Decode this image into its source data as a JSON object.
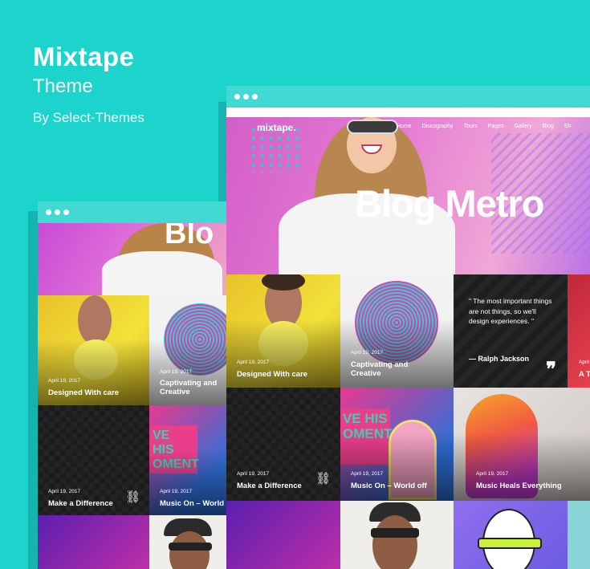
{
  "brand": {
    "title": "Mixtape",
    "subtitle": "Theme",
    "byline": "By Select-Themes"
  },
  "large_window": {
    "logo": "mixtape.",
    "menu": [
      "Home",
      "Discography",
      "Tours",
      "Pages",
      "Gallery",
      "Blog",
      "Sh"
    ],
    "hero_title": "Blog Metro",
    "tiles": {
      "t1": {
        "date": "April 19, 2017",
        "title": "Designed With care"
      },
      "t2": {
        "date": "April 19, 2017",
        "title": "Captivating and Creative"
      },
      "quote": {
        "text": "\" The most important things are not things, so we'll design experiences. \"",
        "author": "— Ralph Jackson"
      },
      "t4": {
        "date": "April",
        "title": "A T"
      },
      "t5": {
        "date": "April 19, 2017",
        "title": "Make a Difference"
      },
      "t6": {
        "date": "April 19, 2017",
        "title": "Music On – World off"
      },
      "t7": {
        "date": "April 19, 2017",
        "title": "Music Heals Everything"
      }
    }
  },
  "small_window": {
    "hero_text": "Blo",
    "tiles": {
      "t1": {
        "date": "April 19, 2017",
        "title": "Designed With care"
      },
      "t2": {
        "date": "April 19, 2017",
        "title": "Captivating and Creative"
      },
      "t3": {
        "date": "April 19, 2017",
        "title": "Make a Difference"
      },
      "t4": {
        "date": "April 19, 2017",
        "title": "Music On – World"
      }
    }
  },
  "icons": {
    "window_dots": "three-dots",
    "link": "link-icon",
    "quote": "quote-icon"
  },
  "colors": {
    "background": "#1cd4cc",
    "bar": "#42d9d3",
    "accent_pink": "#e06fd9"
  }
}
